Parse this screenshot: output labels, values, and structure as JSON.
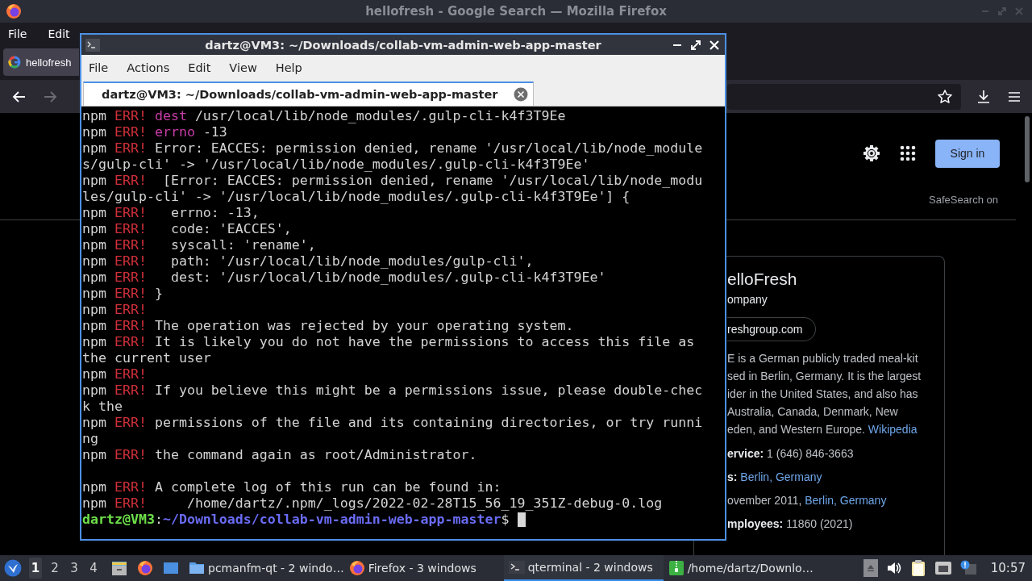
{
  "firefox": {
    "title": "hellofresh - Google Search — Mozilla Firefox",
    "menu": [
      "File",
      "Edit"
    ],
    "tab": {
      "label": "hellofresh",
      "selected": true
    },
    "page": {
      "sign_in": "Sign in",
      "safesearch": "SafeSearch on",
      "panel": {
        "title": "elloFresh",
        "subtitle": "ompany",
        "website": "reshgroup.com",
        "description": [
          "E is a German publicly traded meal-kit",
          "sed in Berlin, Germany. It is the largest",
          "ider in the United States, and also has",
          "Australia, Canada, Denmark, New",
          "eden, and Western Europe."
        ],
        "description_link": "Wikipedia",
        "facts": [
          {
            "label": "ervice:",
            "value": "1 (646) 846-3663"
          },
          {
            "label": "s:",
            "link": "Berlin, Germany"
          },
          {
            "value": "ovember 2011,",
            "link": "Berlin, Germany"
          },
          {
            "label": "mployees:",
            "value": "11860 (2021)"
          }
        ]
      }
    }
  },
  "terminal": {
    "title": "dartz@VM3: ~/Downloads/collab-vm-admin-web-app-master",
    "menu": [
      "File",
      "Actions",
      "Edit",
      "View",
      "Help"
    ],
    "tab": {
      "label": "dartz@VM3: ~/Downloads/collab-vm-admin-web-app-master",
      "selected": true
    },
    "lines": [
      {
        "kind": "npm",
        "head": "npm ",
        "tag": "ERR!",
        "key": " dest",
        "text": " /usr/local/lib/node_modules/.gulp-cli-k4f3T9Ee"
      },
      {
        "kind": "npm",
        "head": "npm ",
        "tag": "ERR!",
        "key": " errno",
        "text": " -13"
      },
      {
        "kind": "npm",
        "head": "npm ",
        "tag": "ERR!",
        "text": " Error: EACCES: permission denied, rename '/usr/local/lib/node_module"
      },
      {
        "kind": "plain",
        "text": "s/gulp-cli' -> '/usr/local/lib/node_modules/.gulp-cli-k4f3T9Ee'"
      },
      {
        "kind": "npm",
        "head": "npm ",
        "tag": "ERR!",
        "text": "  [Error: EACCES: permission denied, rename '/usr/local/lib/node_modu"
      },
      {
        "kind": "plain",
        "text": "les/gulp-cli' -> '/usr/local/lib/node_modules/.gulp-cli-k4f3T9Ee'] {"
      },
      {
        "kind": "npm",
        "head": "npm ",
        "tag": "ERR!",
        "text": "   errno: -13,"
      },
      {
        "kind": "npm",
        "head": "npm ",
        "tag": "ERR!",
        "text": "   code: 'EACCES',"
      },
      {
        "kind": "npm",
        "head": "npm ",
        "tag": "ERR!",
        "text": "   syscall: 'rename',"
      },
      {
        "kind": "npm",
        "head": "npm ",
        "tag": "ERR!",
        "text": "   path: '/usr/local/lib/node_modules/gulp-cli',"
      },
      {
        "kind": "npm",
        "head": "npm ",
        "tag": "ERR!",
        "text": "   dest: '/usr/local/lib/node_modules/.gulp-cli-k4f3T9Ee'"
      },
      {
        "kind": "npm",
        "head": "npm ",
        "tag": "ERR!",
        "text": " }"
      },
      {
        "kind": "npm",
        "head": "npm ",
        "tag": "ERR!"
      },
      {
        "kind": "npm",
        "head": "npm ",
        "tag": "ERR!",
        "text": " The operation was rejected by your operating system."
      },
      {
        "kind": "npm",
        "head": "npm ",
        "tag": "ERR!",
        "text": " It is likely you do not have the permissions to access this file as"
      },
      {
        "kind": "plain",
        "text": "the current user"
      },
      {
        "kind": "npm",
        "head": "npm ",
        "tag": "ERR!"
      },
      {
        "kind": "npm",
        "head": "npm ",
        "tag": "ERR!",
        "text": " If you believe this might be a permissions issue, please double-chec"
      },
      {
        "kind": "plain",
        "text": "k the"
      },
      {
        "kind": "npm",
        "head": "npm ",
        "tag": "ERR!",
        "text": " permissions of the file and its containing directories, or try runni"
      },
      {
        "kind": "plain",
        "text": "ng"
      },
      {
        "kind": "npm",
        "head": "npm ",
        "tag": "ERR!",
        "text": " the command again as root/Administrator."
      },
      {
        "kind": "blank"
      },
      {
        "kind": "npm",
        "head": "npm ",
        "tag": "ERR!",
        "text": " A complete log of this run can be found in:"
      },
      {
        "kind": "npm",
        "head": "npm ",
        "tag": "ERR!",
        "text": "     /home/dartz/.npm/_logs/2022-02-28T15_56_19_351Z-debug-0.log"
      }
    ],
    "prompt": {
      "user": "dartz@VM3",
      "separator": ":",
      "path": "~/Downloads/collab-vm-admin-web-app-master",
      "symbol": "$"
    }
  },
  "taskbar": {
    "workspaces": [
      {
        "label": "1",
        "selected": true
      },
      {
        "label": "2",
        "selected": false
      },
      {
        "label": "3",
        "selected": false
      },
      {
        "label": "4",
        "selected": false
      }
    ],
    "tasks": [
      {
        "kind": "folder",
        "label": "pcmanfm-qt - 2 windo…",
        "selected": false
      },
      {
        "kind": "firefox",
        "label": "Firefox - 3 windows",
        "selected": false
      },
      {
        "kind": "terminal",
        "label": "qterminal - 2 windows",
        "selected": true
      },
      {
        "kind": "archive",
        "label": "/home/dartz/Downlo…",
        "selected": false
      }
    ],
    "clock": "10:57"
  }
}
